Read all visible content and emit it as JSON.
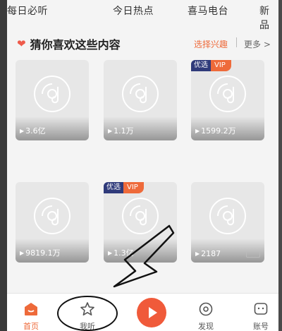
{
  "top_nav": {
    "items": [
      "每日必听",
      "今日热点",
      "喜马电台",
      "新品"
    ]
  },
  "section": {
    "title": "猜你喜欢这些内容",
    "select_interest": "选择兴趣",
    "more": "更多 >"
  },
  "cards": [
    {
      "plays": "3.6亿"
    },
    {
      "plays": "1.1万"
    },
    {
      "plays": "1599.2万",
      "badge_left": "优选",
      "badge_right": "VIP"
    },
    {
      "plays": "9819.1万"
    },
    {
      "plays": "1.3亿",
      "badge_left": "优选",
      "badge_right": "VIP"
    },
    {
      "plays": "2187"
    }
  ],
  "tabbar": {
    "home": "首页",
    "listen": "我听",
    "discover": "发现",
    "account": "账号"
  },
  "colors": {
    "accent": "#ee6a3a",
    "badge_dark": "#2f3a7a"
  },
  "icons": [
    "heart-icon",
    "disc-placeholder-icon",
    "play-triangle-icon",
    "home-icon",
    "star-icon",
    "play-icon",
    "discover-icon",
    "account-icon"
  ]
}
